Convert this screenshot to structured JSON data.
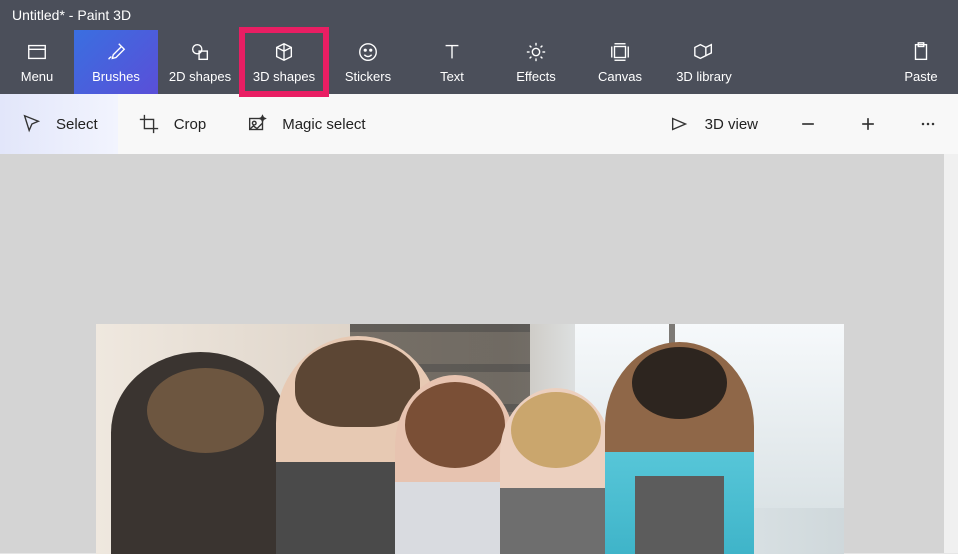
{
  "title": "Untitled* - Paint 3D",
  "ribbon": {
    "menu": "Menu",
    "brushes": "Brushes",
    "shapes2d": "2D shapes",
    "shapes3d": "3D shapes",
    "stickers": "Stickers",
    "text": "Text",
    "effects": "Effects",
    "canvas": "Canvas",
    "library3d": "3D library",
    "paste": "Paste"
  },
  "toolbar": {
    "select": "Select",
    "crop": "Crop",
    "magic_select": "Magic select",
    "view3d": "3D view"
  },
  "highlighted_tool": "3D shapes",
  "active_tool": "Brushes",
  "selected_toolbar": "Select"
}
